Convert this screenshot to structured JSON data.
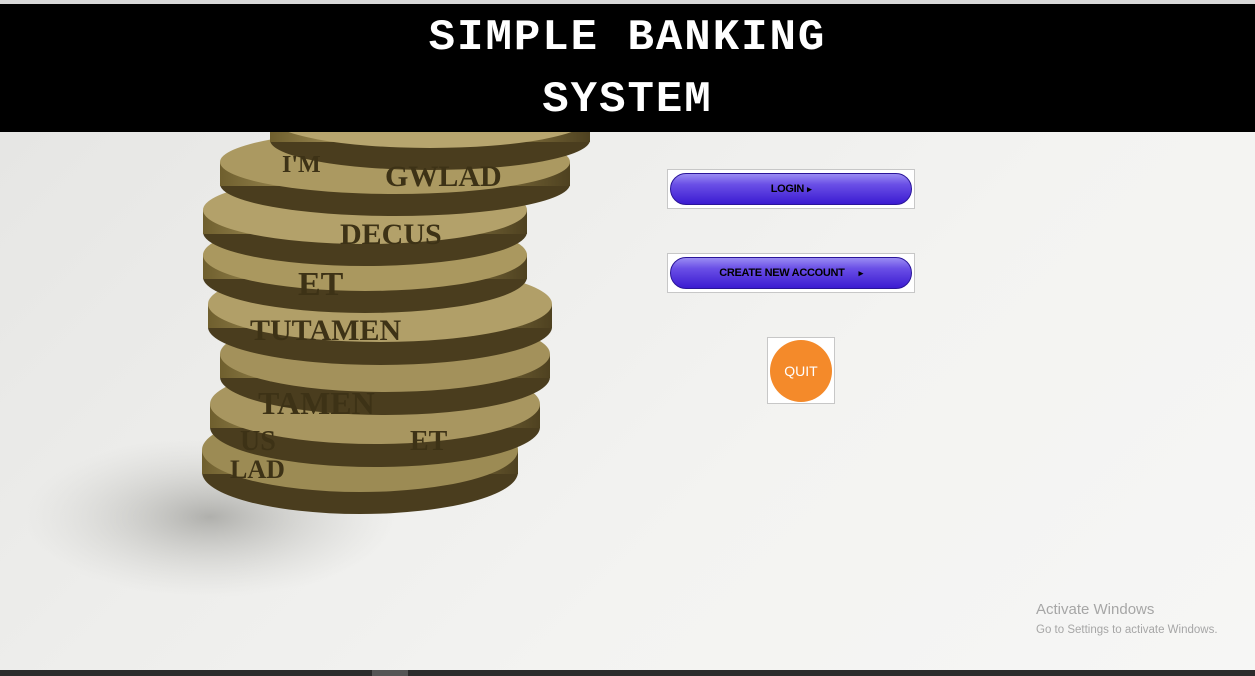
{
  "header": {
    "title_line1": "SIMPLE BANKING",
    "title_line2": "SYSTEM"
  },
  "buttons": {
    "login": {
      "label": "LOGIN",
      "arrow": "▸"
    },
    "create_account": {
      "label": "CREATE NEW ACCOUNT",
      "arrow": "▸"
    },
    "quit": {
      "label": "QUIT"
    }
  },
  "background_image": {
    "coin_texts": [
      "I'M",
      "GWLAD",
      "DECUS",
      "ET",
      "TUTAMEN",
      "TAMEN",
      "US",
      "ET",
      "LAD"
    ]
  },
  "watermark": {
    "line1": "Activate Windows",
    "line2": "Go to Settings to activate Windows."
  },
  "colors": {
    "header_bg": "#000000",
    "button_accent": "#3b1bd1",
    "quit": "#f48a2a"
  }
}
